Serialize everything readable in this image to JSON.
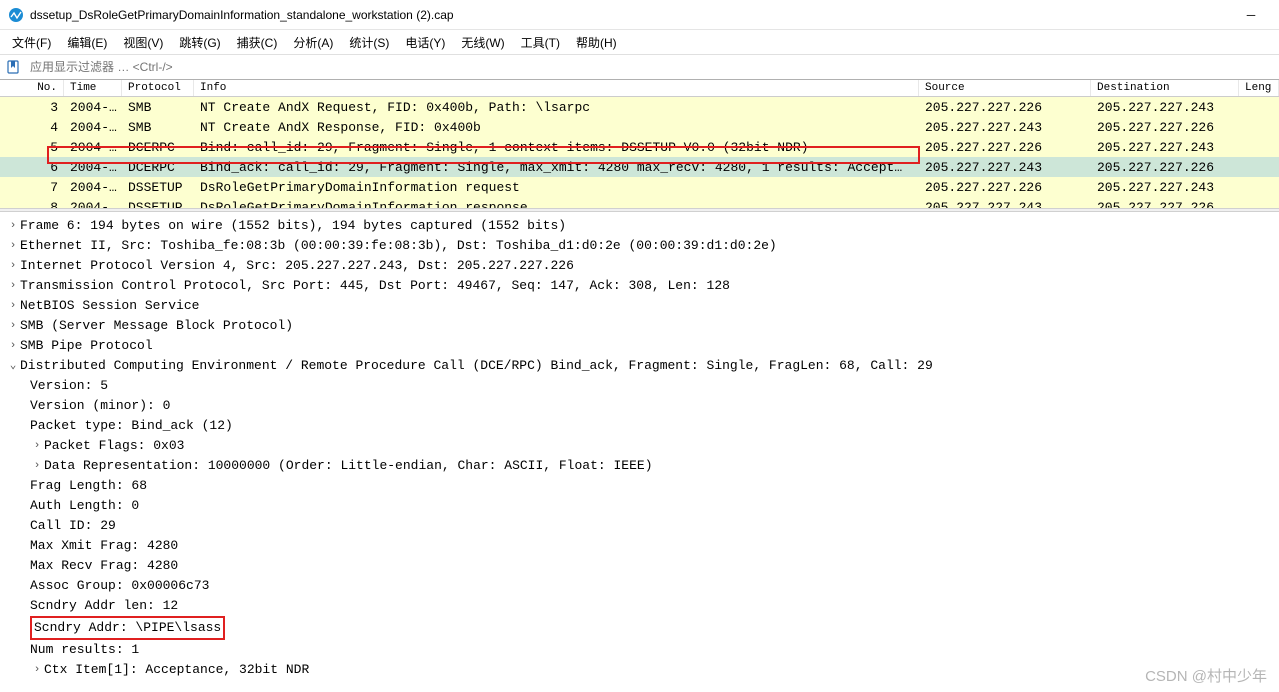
{
  "window": {
    "title": "dssetup_DsRoleGetPrimaryDomainInformation_standalone_workstation (2).cap"
  },
  "menu": {
    "file": "文件(F)",
    "edit": "编辑(E)",
    "view": "视图(V)",
    "go": "跳转(G)",
    "capture": "捕获(C)",
    "analyze": "分析(A)",
    "statistics": "统计(S)",
    "telephony": "电话(Y)",
    "wireless": "无线(W)",
    "tools": "工具(T)",
    "help": "帮助(H)"
  },
  "filter": {
    "placeholder": "应用显示过滤器 … <Ctrl-/>"
  },
  "columns": {
    "no": "No.",
    "time": "Time",
    "protocol": "Protocol",
    "info": "Info",
    "source": "Source",
    "destination": "Destination",
    "length": "Leng"
  },
  "packets": [
    {
      "no": "3",
      "time": "2004-…",
      "proto": "SMB",
      "info": "NT Create AndX Request, FID: 0x400b, Path: \\lsarpc",
      "src": "205.227.227.226",
      "dst": "205.227.227.243",
      "cls": "row-smb"
    },
    {
      "no": "4",
      "time": "2004-…",
      "proto": "SMB",
      "info": "NT Create AndX Response, FID: 0x400b",
      "src": "205.227.227.243",
      "dst": "205.227.227.226",
      "cls": "row-smb"
    },
    {
      "no": "5",
      "time": "2004-…",
      "proto": "DCERPC",
      "info": "Bind: call_id: 29, Fragment: Single, 1 context items: DSSETUP V0.0 (32bit NDR)",
      "src": "205.227.227.226",
      "dst": "205.227.227.243",
      "cls": "row-smb"
    },
    {
      "no": "6",
      "time": "2004-…",
      "proto": "DCERPC",
      "info": "Bind_ack: call_id: 29, Fragment: Single, max_xmit: 4280 max_recv: 4280, 1 results: Accept…",
      "src": "205.227.227.243",
      "dst": "205.227.227.226",
      "cls": "row-selected"
    },
    {
      "no": "7",
      "time": "2004-…",
      "proto": "DSSETUP",
      "info": "DsRoleGetPrimaryDomainInformation request",
      "src": "205.227.227.226",
      "dst": "205.227.227.243",
      "cls": "row-smb"
    },
    {
      "no": "8",
      "time": "2004-…",
      "proto": "DSSETUP",
      "info": "DsRoleGetPrimaryDomainInformation response",
      "src": "205.227.227.243",
      "dst": "205.227.227.226",
      "cls": "row-smb"
    }
  ],
  "details": {
    "frame": "Frame 6: 194 bytes on wire (1552 bits), 194 bytes captured (1552 bits)",
    "eth": "Ethernet II, Src: Toshiba_fe:08:3b (00:00:39:fe:08:3b), Dst: Toshiba_d1:d0:2e (00:00:39:d1:d0:2e)",
    "ip": "Internet Protocol Version 4, Src: 205.227.227.243, Dst: 205.227.227.226",
    "tcp": "Transmission Control Protocol, Src Port: 445, Dst Port: 49467, Seq: 147, Ack: 308, Len: 128",
    "nbss": "NetBIOS Session Service",
    "smb": "SMB (Server Message Block Protocol)",
    "smbpipe": "SMB Pipe Protocol",
    "dcerpc": "Distributed Computing Environment / Remote Procedure Call (DCE/RPC) Bind_ack, Fragment: Single, FragLen: 68, Call: 29",
    "version": "Version: 5",
    "version_minor": "Version (minor): 0",
    "packet_type": "Packet type: Bind_ack (12)",
    "packet_flags": "Packet Flags: 0x03",
    "data_rep": "Data Representation: 10000000 (Order: Little-endian, Char: ASCII, Float: IEEE)",
    "frag_len": "Frag Length: 68",
    "auth_len": "Auth Length: 0",
    "call_id": "Call ID: 29",
    "max_xmit": "Max Xmit Frag: 4280",
    "max_recv": "Max Recv Frag: 4280",
    "assoc_group": "Assoc Group: 0x00006c73",
    "scndry_len": "Scndry Addr len: 12",
    "scndry_addr": "Scndry Addr: \\PIPE\\lsass",
    "num_results": "Num results: 1",
    "ctx_item": "Ctx Item[1]: Acceptance, 32bit NDR"
  },
  "watermark": "CSDN @村中少年"
}
